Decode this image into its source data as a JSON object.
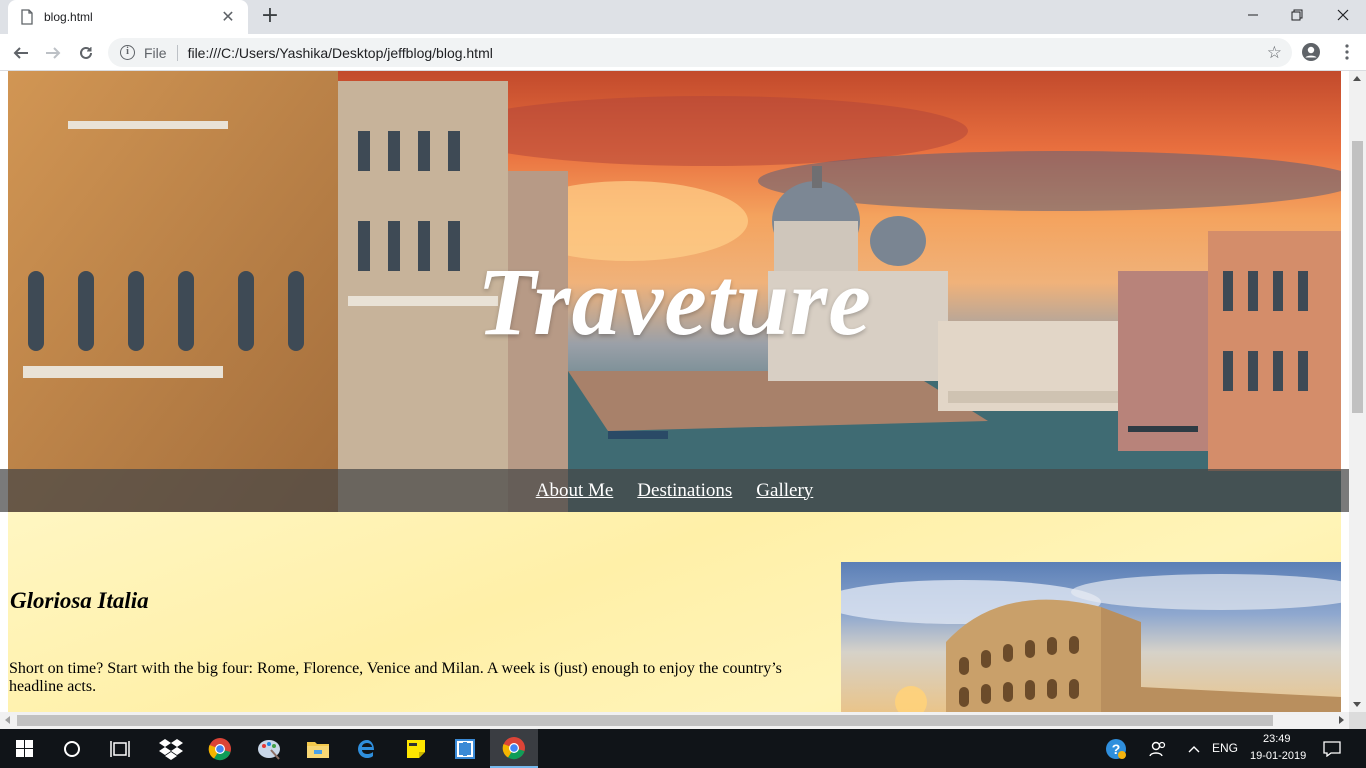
{
  "browser": {
    "tab_title": "blog.html",
    "scheme_label": "File",
    "url": "file:///C:/Users/Yashika/Desktop/jeffblog/blog.html"
  },
  "hero": {
    "title": "Traveture"
  },
  "nav": {
    "items": [
      "About Me",
      "Destinations",
      "Gallery"
    ]
  },
  "post": {
    "title": "Gloriosa Italia",
    "body": "Short on time? Start with the big four: Rome, Florence, Venice and Milan. A week is (just) enough to enjoy the country’s headline acts."
  },
  "taskbar": {
    "language": "ENG",
    "time": "23:49",
    "date": "19-01-2019"
  },
  "colors": {
    "content_bg": "#fff2b3",
    "navbar_bg": "#464646",
    "taskbar_bg": "#101418",
    "active_accent": "#76b9ed"
  }
}
